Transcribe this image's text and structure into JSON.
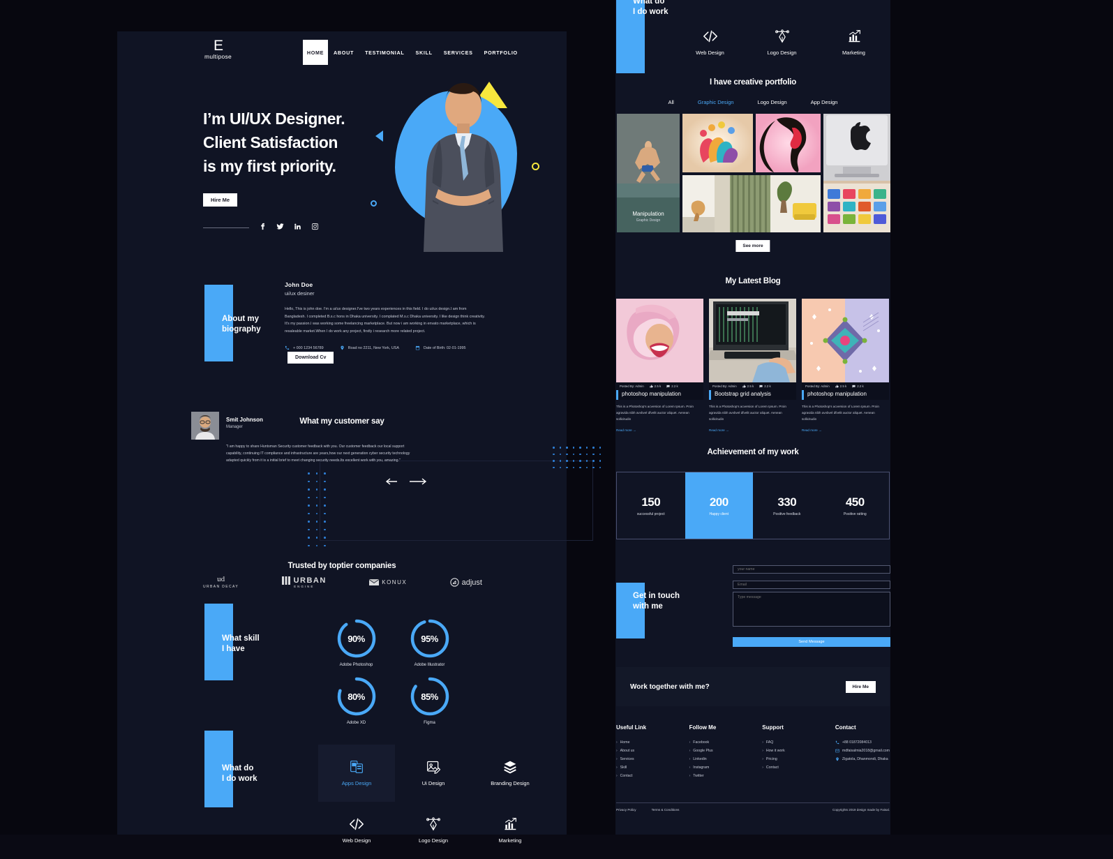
{
  "brand": {
    "mark": "E",
    "name": "multipose"
  },
  "nav": {
    "items": [
      {
        "label": "HOME",
        "active": true
      },
      {
        "label": "ABOUT",
        "active": false
      },
      {
        "label": "TESTIMONIAL",
        "active": false
      },
      {
        "label": "SKILL",
        "active": false
      },
      {
        "label": "SERVICES",
        "active": false
      },
      {
        "label": "PORTFOLIO",
        "active": false
      }
    ]
  },
  "hero": {
    "line1": "I’m UI/UX Designer.",
    "line2": "Client Satisfaction",
    "line3": "is my first priority.",
    "cta": "Hire Me",
    "socials": [
      "facebook-icon",
      "twitter-icon",
      "linkedin-icon",
      "instagram-icon"
    ]
  },
  "about": {
    "heading_l1": "About my",
    "heading_l2": "biography",
    "name": "John Doe",
    "role": "ui/ux desiner",
    "text": "Hello, This is john doe. I'm a ui/ux designer.I've two years experiences in this field. I do ui/ux design.I am from Bangladesh. I completed B.s.c hons in Dhaka university. I complated M.s.c Dhaka university. I like design think creativity. It's my passion.I was working some freelancing marketplace. But now i am working in envato marketplace, which is resaleable market.When I do work any project, firstly i research more related project.",
    "phone": "+ 000 1234 56789",
    "address": "Road no 2211, New York, USA",
    "dob": "Date of Birth: 02-01-1995",
    "download": "Download Cv"
  },
  "testimonial": {
    "title": "What my customer say",
    "name": "Smit Johnson",
    "role": "Manager",
    "quote": "\"I am happy to share Huntsman Security customer feedback with you.  Our customer feedback our local support capability, continuing IT compliance and infrastructure are years,how our next generation cyber security technology adapted quickly from it is a initial brief to meet changing security needs.Its excellent work with you, amazing.\"",
    "prev": "prev-arrow",
    "next": "next-arrow"
  },
  "brands": {
    "title": "Trusted by toptier companies",
    "items": [
      {
        "mark": "ud",
        "name": "URBAN DECAY"
      },
      {
        "mark": "URBAN",
        "name": "ENGINE"
      },
      {
        "mark": "KONUX",
        "name": ""
      },
      {
        "mark": "adjust",
        "name": ""
      }
    ]
  },
  "skills": {
    "heading_l1": "What skill",
    "heading_l2": "I have",
    "items": [
      {
        "label": "Adobe Photoshop",
        "value": 90,
        "display": "90%"
      },
      {
        "label": "Adobe Illustrator",
        "value": 95,
        "display": "95%"
      },
      {
        "label": "Adobe XD",
        "value": 80,
        "display": "80%"
      },
      {
        "label": "Figma",
        "value": 85,
        "display": "85%"
      }
    ]
  },
  "services": {
    "heading_l1": "What do",
    "heading_l2": "I do work",
    "items": [
      {
        "label": "Apps Design",
        "icon": "mobile-apps-icon",
        "highlighted": true
      },
      {
        "label": "Ui Design",
        "icon": "image-edit-icon",
        "highlighted": false
      },
      {
        "label": "Branding Design",
        "icon": "layers-icon",
        "highlighted": false
      },
      {
        "label": "Web Design",
        "icon": "code-brackets-icon",
        "highlighted": false
      },
      {
        "label": "Logo Design",
        "icon": "pen-tool-icon",
        "highlighted": false
      },
      {
        "label": "Marketing",
        "icon": "bar-chart-icon",
        "highlighted": false
      }
    ]
  },
  "portfolio": {
    "title": "I have creative portfolio",
    "tabs": [
      {
        "label": "All",
        "active": false
      },
      {
        "label": "Graphic Design",
        "active": true
      },
      {
        "label": "Logo Design",
        "active": false
      },
      {
        "label": "App Design",
        "active": false
      }
    ],
    "featured": {
      "title": "Manipulation",
      "category": "Graphic Design"
    },
    "see_more": "See more"
  },
  "blog": {
    "title": "My Latest Blog",
    "posts": [
      {
        "author": "Posted By: Admin",
        "likes": "2.5 k",
        "comments": "2.2 k",
        "title": "photoshop manipulation",
        "excerpt": "This is a Photoshop's acversion  of Lorem Ipsum. Proin agravida nibh avvbvel dfvelit auctor aliquet. Aenean sollicitudin",
        "read_more": "Read more  →"
      },
      {
        "author": "Posted By: Admin",
        "likes": "2.5 k",
        "comments": "2.2 k",
        "title": "Bootstrap grid analysis",
        "excerpt": "This is a Photoshop's acversion  of Lorem Ipsum. Proin agravida nibh avvbvel dfvelit auctor aliquet. Aenean sollicitudin",
        "read_more": "Read more  →"
      },
      {
        "author": "Posted By: Admin",
        "likes": "2.5 k",
        "comments": "2.2 k",
        "title": "photoshop manipulation",
        "excerpt": "This is a Photoshop's acversion  of Lorem Ipsum. Proin agravida nibh avvbvel dfvelit auctor aliquet. Aenean sollicitudin",
        "read_more": "Read more  →"
      }
    ]
  },
  "achievement": {
    "title": "Achievement of my work",
    "stats": [
      {
        "number": "150",
        "label": "successful project",
        "highlighted": false
      },
      {
        "number": "200",
        "label": "Happy client",
        "highlighted": true
      },
      {
        "number": "330",
        "label": "Positive feedback",
        "highlighted": false
      },
      {
        "number": "450",
        "label": "Positive ratting",
        "highlighted": false
      }
    ]
  },
  "contact": {
    "heading_l1": "Get in touch",
    "heading_l2": "with me",
    "name_placeholder": "your name",
    "email_placeholder": "Email",
    "message_placeholder": "Type message",
    "submit": "Send Message"
  },
  "work_together": {
    "text": "Work together with me?",
    "cta": "Hire Me"
  },
  "footer": {
    "columns": [
      {
        "title": "Useful Link",
        "items": [
          "Home",
          "About us",
          "Services",
          "Skill",
          "Contact"
        ]
      },
      {
        "title": "Follow Me",
        "items": [
          "Facebook",
          "Google Plus",
          "Linkedin",
          "Instagram",
          "Twitter"
        ]
      },
      {
        "title": "Support",
        "items": [
          "FAQ",
          "How it work",
          "Pricing",
          "Contact"
        ]
      }
    ],
    "contact": {
      "title": "Contact",
      "items": [
        {
          "icon": "phone-icon",
          "text": "+88 01872084013"
        },
        {
          "icon": "mail-icon",
          "text": "mdfaisalmia2018@gmail.com"
        },
        {
          "icon": "location-icon",
          "text": "Zigatola, Dhanmondi, Dhaka"
        }
      ]
    },
    "bottom_links": [
      "Privacy Policy",
      "Terms & Conditions"
    ],
    "copyright": "Copyrights 2019 design made by Faisal."
  },
  "colors": {
    "accent": "#4aa9f7",
    "yellow": "#f7e73d",
    "panel": "#101424",
    "bg": "#07070f"
  }
}
